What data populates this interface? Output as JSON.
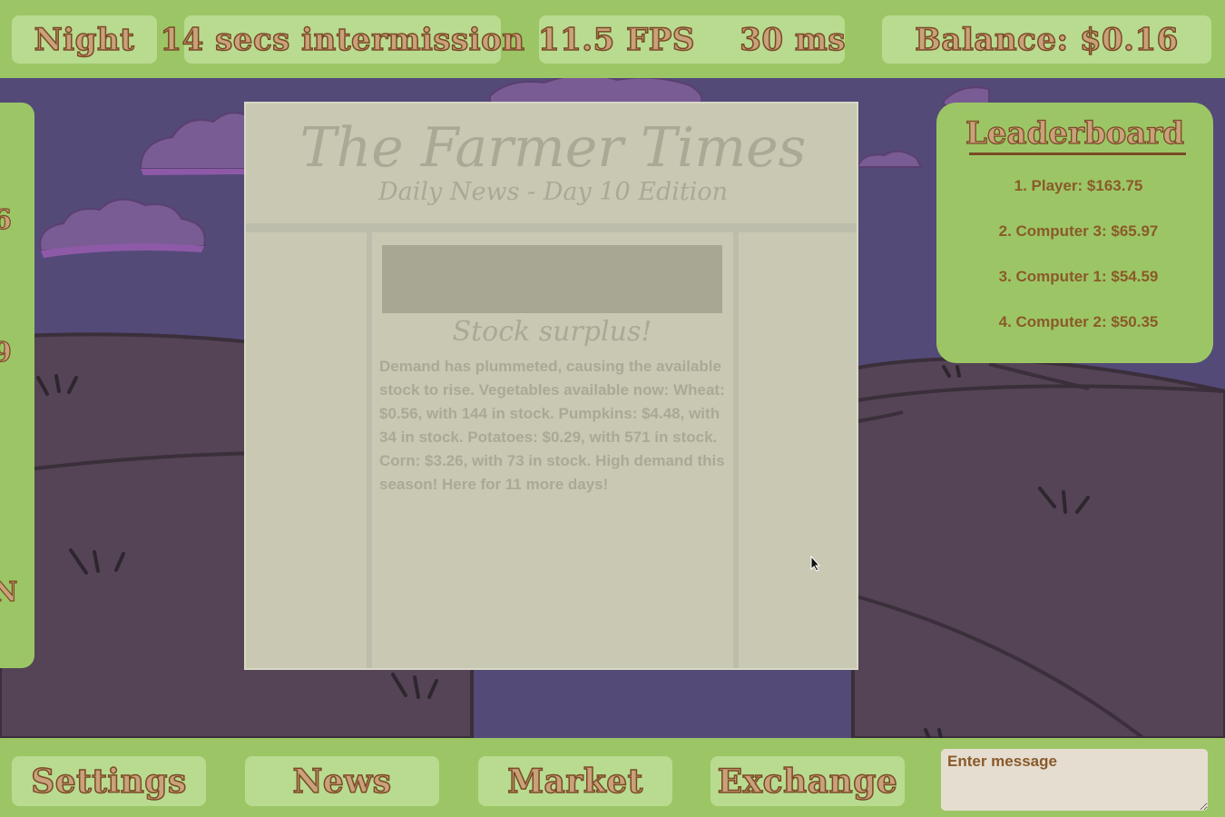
{
  "topbar": {
    "phase": "Night",
    "timer": "14 secs intermission",
    "perf": "11.5 FPS    30 ms",
    "balance": "Balance: $0.16"
  },
  "side_panel": {
    "visible_fragments": [
      "6",
      "9",
      "N"
    ]
  },
  "newspaper": {
    "title": "The Farmer Times",
    "subtitle": "Daily News - Day 10 Edition",
    "headline": "Stock surplus!",
    "body": "Demand has plummeted, causing the available stock to rise. Vegetables available now: Wheat: $0.56, with 144 in stock. Pumpkins: $4.48, with 34 in stock. Potatoes: $0.29, with 571 in stock. Corn: $3.26, with 73 in stock. High demand this season! Here for 11 more days!"
  },
  "leaderboard": {
    "title": "Leaderboard",
    "entries": [
      "1. Player: $163.75",
      "2. Computer 3: $65.97",
      "3. Computer 1: $54.59",
      "4. Computer 2: $50.35"
    ]
  },
  "bottombar": {
    "settings": "Settings",
    "news": "News",
    "market": "Market",
    "exchange": "Exchange",
    "message_placeholder": "Enter message"
  },
  "colors": {
    "bar_green": "#9cc665",
    "pill_green": "#b8db90",
    "label_fill": "#c9a17a",
    "label_outline": "#7a4a25",
    "sky": "#534a78",
    "hills": "#554455",
    "newspaper": "#c8c8b3"
  }
}
